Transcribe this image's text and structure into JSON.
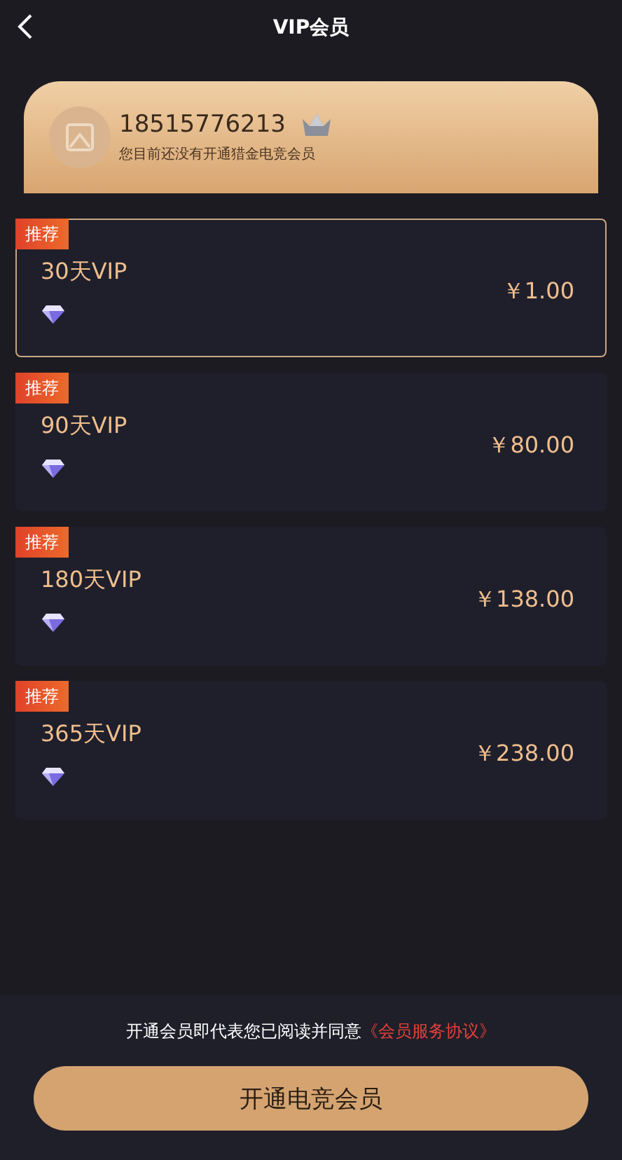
{
  "header": {
    "title": "VIP会员"
  },
  "user": {
    "phone": "18515776213",
    "notice": "您目前还没有开通猎金电竞会员"
  },
  "plans": [
    {
      "badge": "推荐",
      "name": "30天VIP",
      "price": "￥1.00",
      "selected": true
    },
    {
      "badge": "推荐",
      "name": "90天VIP",
      "price": "￥80.00",
      "selected": false
    },
    {
      "badge": "推荐",
      "name": "180天VIP",
      "price": "￥138.00",
      "selected": false
    },
    {
      "badge": "推荐",
      "name": "365天VIP",
      "price": "￥238.00",
      "selected": false
    }
  ],
  "footer": {
    "agreement": "开通会员即代表您已阅读并同意",
    "agreement_link": "《会员服务协议》",
    "button": "开通电竞会员"
  }
}
